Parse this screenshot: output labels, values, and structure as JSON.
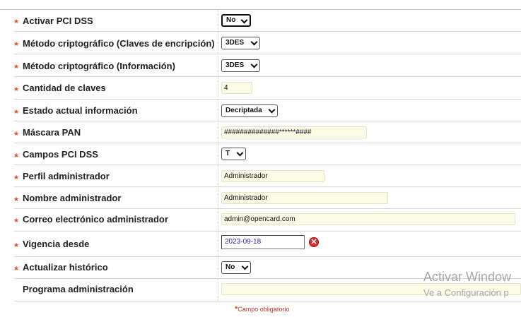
{
  "form": {
    "rows": [
      {
        "label": "Activar PCI DSS",
        "required": true,
        "control": "select",
        "value": "No"
      },
      {
        "label": "Método criptográfico (Claves de encripción)",
        "required": true,
        "control": "select",
        "value": "3DES"
      },
      {
        "label": "Método criptográfico (Información)",
        "required": true,
        "control": "select",
        "value": "3DES"
      },
      {
        "label": "Cantidad de claves",
        "required": true,
        "control": "input",
        "value": "4"
      },
      {
        "label": "Estado actual información",
        "required": true,
        "control": "select",
        "value": "Decriptada"
      },
      {
        "label": "Máscara PAN",
        "required": true,
        "control": "input",
        "value": "##############******####"
      },
      {
        "label": "Campos PCI DSS",
        "required": true,
        "control": "select",
        "value": "T"
      },
      {
        "label": "Perfil administrador",
        "required": true,
        "control": "input",
        "value": "Administrador"
      },
      {
        "label": "Nombre administrador",
        "required": true,
        "control": "input",
        "value": "Administrador"
      },
      {
        "label": "Correo electrónico administrador",
        "required": true,
        "control": "input",
        "value": "admin@opencard.com"
      },
      {
        "label": "Vigencia desde",
        "required": true,
        "control": "date",
        "value": "2023-09-18"
      },
      {
        "label": "Actualizar histórico",
        "required": true,
        "control": "select",
        "value": "No"
      },
      {
        "label": "Programa administración",
        "required": false,
        "control": "input",
        "value": ""
      }
    ],
    "required_mark": "*",
    "required_note": "Campo obligatorio"
  },
  "watermark": {
    "line1": "Activar Window",
    "line2": "Ve a Configuración p"
  },
  "colors": {
    "required_star": "#e04a1c",
    "input_bg": "#fbfbe6",
    "date_text": "#2b2bb5",
    "clear_button": "#d32f2f"
  },
  "icons": {
    "clear_date": "close-circle-icon",
    "dropdown": "chevron-down-icon"
  }
}
